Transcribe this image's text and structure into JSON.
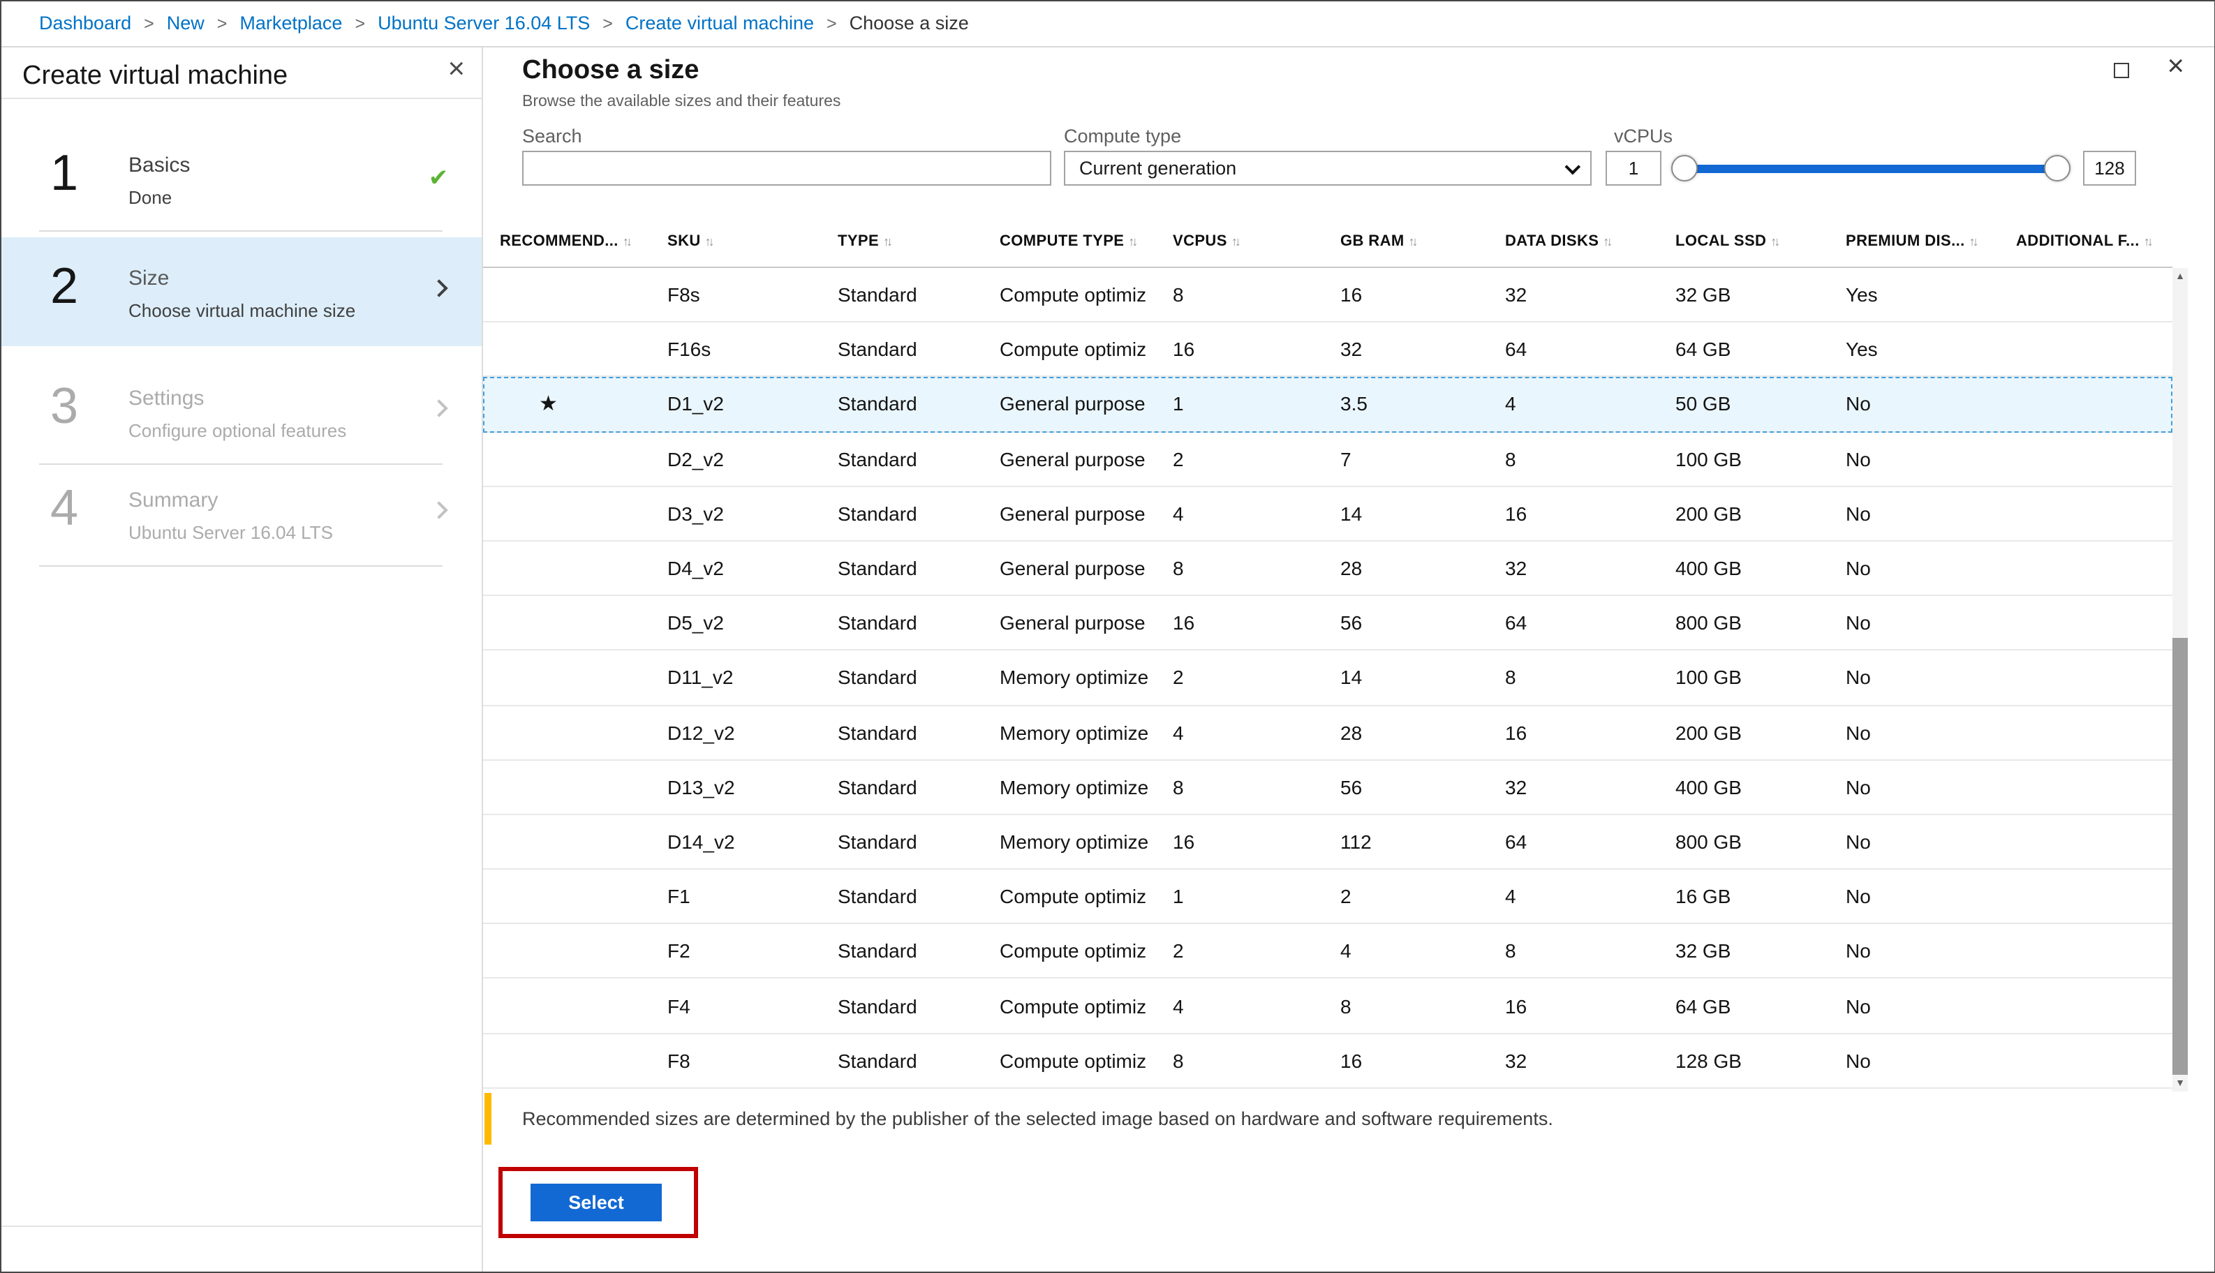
{
  "breadcrumb": {
    "separator": ">",
    "items": [
      {
        "label": "Dashboard",
        "link": true
      },
      {
        "label": "New",
        "link": true
      },
      {
        "label": "Marketplace",
        "link": true
      },
      {
        "label": "Ubuntu Server 16.04 LTS",
        "link": true
      },
      {
        "label": "Create virtual machine",
        "link": true
      },
      {
        "label": "Choose a size",
        "link": false
      }
    ]
  },
  "left_panel": {
    "title": "Create virtual machine",
    "steps": [
      {
        "number": "1",
        "label": "Basics",
        "sublabel": "Done",
        "status": "done"
      },
      {
        "number": "2",
        "label": "Size",
        "sublabel": "Choose virtual machine size",
        "status": "active"
      },
      {
        "number": "3",
        "label": "Settings",
        "sublabel": "Configure optional features",
        "status": "disabled"
      },
      {
        "number": "4",
        "label": "Summary",
        "sublabel": "Ubuntu Server 16.04 LTS",
        "status": "disabled"
      }
    ]
  },
  "panel": {
    "title": "Choose a size",
    "subtitle": "Browse the available sizes and their features",
    "filters": {
      "search_label": "Search",
      "search_value": "",
      "compute_type_label": "Compute type",
      "compute_type_value": "Current generation",
      "vcpus_label": "vCPUs",
      "vcpus_min": "1",
      "vcpus_max": "128"
    },
    "table": {
      "columns": [
        "RECOMMEND...",
        "SKU",
        "TYPE",
        "COMPUTE TYPE",
        "VCPUS",
        "GB RAM",
        "DATA DISKS",
        "LOCAL SSD",
        "PREMIUM DIS...",
        "ADDITIONAL F..."
      ],
      "rows": [
        {
          "recommended": "",
          "sku": "F8s",
          "type": "Standard",
          "compute_type": "Compute optimiz",
          "vcpus": "8",
          "gb_ram": "16",
          "data_disks": "32",
          "local_ssd": "32 GB",
          "premium": "Yes",
          "additional": "",
          "selected": false
        },
        {
          "recommended": "",
          "sku": "F16s",
          "type": "Standard",
          "compute_type": "Compute optimiz",
          "vcpus": "16",
          "gb_ram": "32",
          "data_disks": "64",
          "local_ssd": "64 GB",
          "premium": "Yes",
          "additional": "",
          "selected": false
        },
        {
          "recommended": "★",
          "sku": "D1_v2",
          "type": "Standard",
          "compute_type": "General purpose",
          "vcpus": "1",
          "gb_ram": "3.5",
          "data_disks": "4",
          "local_ssd": "50 GB",
          "premium": "No",
          "additional": "",
          "selected": true
        },
        {
          "recommended": "",
          "sku": "D2_v2",
          "type": "Standard",
          "compute_type": "General purpose",
          "vcpus": "2",
          "gb_ram": "7",
          "data_disks": "8",
          "local_ssd": "100 GB",
          "premium": "No",
          "additional": "",
          "selected": false
        },
        {
          "recommended": "",
          "sku": "D3_v2",
          "type": "Standard",
          "compute_type": "General purpose",
          "vcpus": "4",
          "gb_ram": "14",
          "data_disks": "16",
          "local_ssd": "200 GB",
          "premium": "No",
          "additional": "",
          "selected": false
        },
        {
          "recommended": "",
          "sku": "D4_v2",
          "type": "Standard",
          "compute_type": "General purpose",
          "vcpus": "8",
          "gb_ram": "28",
          "data_disks": "32",
          "local_ssd": "400 GB",
          "premium": "No",
          "additional": "",
          "selected": false
        },
        {
          "recommended": "",
          "sku": "D5_v2",
          "type": "Standard",
          "compute_type": "General purpose",
          "vcpus": "16",
          "gb_ram": "56",
          "data_disks": "64",
          "local_ssd": "800 GB",
          "premium": "No",
          "additional": "",
          "selected": false
        },
        {
          "recommended": "",
          "sku": "D11_v2",
          "type": "Standard",
          "compute_type": "Memory optimize",
          "vcpus": "2",
          "gb_ram": "14",
          "data_disks": "8",
          "local_ssd": "100 GB",
          "premium": "No",
          "additional": "",
          "selected": false
        },
        {
          "recommended": "",
          "sku": "D12_v2",
          "type": "Standard",
          "compute_type": "Memory optimize",
          "vcpus": "4",
          "gb_ram": "28",
          "data_disks": "16",
          "local_ssd": "200 GB",
          "premium": "No",
          "additional": "",
          "selected": false
        },
        {
          "recommended": "",
          "sku": "D13_v2",
          "type": "Standard",
          "compute_type": "Memory optimize",
          "vcpus": "8",
          "gb_ram": "56",
          "data_disks": "32",
          "local_ssd": "400 GB",
          "premium": "No",
          "additional": "",
          "selected": false
        },
        {
          "recommended": "",
          "sku": "D14_v2",
          "type": "Standard",
          "compute_type": "Memory optimize",
          "vcpus": "16",
          "gb_ram": "112",
          "data_disks": "64",
          "local_ssd": "800 GB",
          "premium": "No",
          "additional": "",
          "selected": false
        },
        {
          "recommended": "",
          "sku": "F1",
          "type": "Standard",
          "compute_type": "Compute optimiz",
          "vcpus": "1",
          "gb_ram": "2",
          "data_disks": "4",
          "local_ssd": "16 GB",
          "premium": "No",
          "additional": "",
          "selected": false
        },
        {
          "recommended": "",
          "sku": "F2",
          "type": "Standard",
          "compute_type": "Compute optimiz",
          "vcpus": "2",
          "gb_ram": "4",
          "data_disks": "8",
          "local_ssd": "32 GB",
          "premium": "No",
          "additional": "",
          "selected": false
        },
        {
          "recommended": "",
          "sku": "F4",
          "type": "Standard",
          "compute_type": "Compute optimiz",
          "vcpus": "4",
          "gb_ram": "8",
          "data_disks": "16",
          "local_ssd": "64 GB",
          "premium": "No",
          "additional": "",
          "selected": false
        },
        {
          "recommended": "",
          "sku": "F8",
          "type": "Standard",
          "compute_type": "Compute optimiz",
          "vcpus": "8",
          "gb_ram": "16",
          "data_disks": "32",
          "local_ssd": "128 GB",
          "premium": "No",
          "additional": "",
          "selected": false
        }
      ]
    },
    "note": "Recommended sizes are determined by the publisher of the selected image based on hardware and software requirements.",
    "select_button": "Select"
  },
  "icons": {
    "close": "×",
    "check": "✔",
    "star": "★",
    "sort": "↑↓",
    "scroll_up": "▲",
    "scroll_down": "▼"
  },
  "colors": {
    "accent_blue": "#0072c6",
    "button_blue": "#1269d3",
    "active_step_bg": "#ddeefa",
    "selected_row_bg": "#eaf6fd",
    "selected_row_border": "#3f9fe0",
    "warning_bar": "#ffb900",
    "annotation_red": "#c00000",
    "done_check_green": "#5cb335"
  }
}
